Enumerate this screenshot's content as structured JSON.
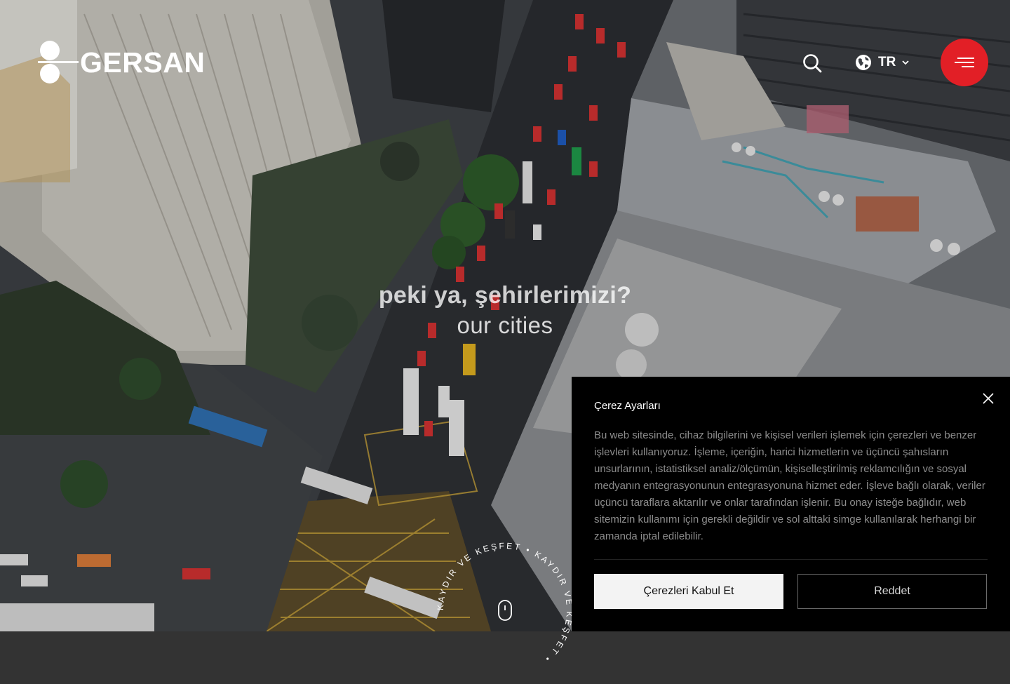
{
  "brand": {
    "name": "GERSAN",
    "mark_ticks": "~~~",
    "accent": "#e21f26"
  },
  "header": {
    "search_icon": "search-icon",
    "language": {
      "icon": "globe-icon",
      "label": "TR",
      "chevron": "chevron-down-icon"
    },
    "menu_icon": "hamburger-icon"
  },
  "hero": {
    "headline": "peki ya, şehirlerimizi?",
    "subline": "our cities",
    "scroll_text": "KAYDIR VE KEŞFET • KAYDIR VE KEŞFET • "
  },
  "cookie_banner": {
    "title": "Çerez Ayarları",
    "body": "Bu web sitesinde, cihaz bilgilerini ve kişisel verileri işlemek için çerezleri ve benzer işlevleri kullanıyoruz. İşleme, içeriğin, harici hizmetlerin ve üçüncü şahısların unsurlarının, istatistiksel analiz/ölçümün, kişiselleştirilmiş reklamcılığın ve sosyal medyanın entegrasyonunun entegrasyonuna hizmet eder. İşleve bağlı olarak, veriler üçüncü taraflara aktarılır ve onlar tarafından işlenir. Bu onay isteğe bağlıdır, web sitemizin kullanımı için gerekli değildir ve sol alttaki simge kullanılarak herhangi bir zamanda iptal edilebilir.",
    "accept_label": "Çerezleri Kabul Et",
    "reject_label": "Reddet",
    "close_icon": "close-icon"
  }
}
